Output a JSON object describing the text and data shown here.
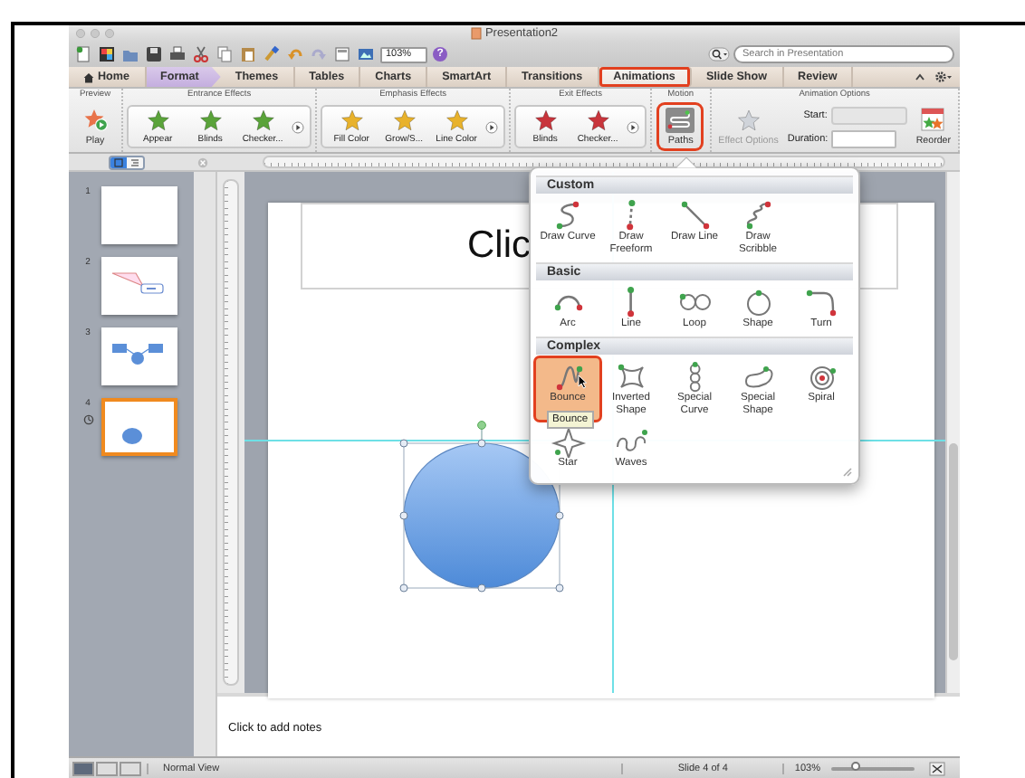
{
  "window": {
    "title": "Presentation2"
  },
  "toolbar": {
    "zoom": "103%",
    "help": "?",
    "search": {
      "placeholder": "Search in Presentation"
    }
  },
  "tabs": [
    {
      "label": "Home",
      "kind": "icon-label",
      "selected": false,
      "contextual": false,
      "highlighted": false
    },
    {
      "label": "Format",
      "kind": "label",
      "selected": false,
      "contextual": true,
      "highlighted": false
    },
    {
      "label": "Themes",
      "kind": "label",
      "selected": false,
      "contextual": false,
      "highlighted": false
    },
    {
      "label": "Tables",
      "kind": "label",
      "selected": false,
      "contextual": false,
      "highlighted": false
    },
    {
      "label": "Charts",
      "kind": "label",
      "selected": false,
      "contextual": false,
      "highlighted": false
    },
    {
      "label": "SmartArt",
      "kind": "label",
      "selected": false,
      "contextual": false,
      "highlighted": false
    },
    {
      "label": "Transitions",
      "kind": "label",
      "selected": false,
      "contextual": false,
      "highlighted": false
    },
    {
      "label": "Animations",
      "kind": "label",
      "selected": true,
      "contextual": false,
      "highlighted": true
    },
    {
      "label": "Slide Show",
      "kind": "label",
      "selected": false,
      "contextual": false,
      "highlighted": false
    },
    {
      "label": "Review",
      "kind": "label",
      "selected": false,
      "contextual": false,
      "highlighted": false
    }
  ],
  "ribbon": [
    {
      "kind": "preview",
      "title": "Preview",
      "button": "Play"
    },
    {
      "kind": "effects",
      "title": "Entrance Effects",
      "color": "#5aa33a",
      "items": [
        "Appear",
        "Blinds",
        "Checker..."
      ]
    },
    {
      "kind": "effects",
      "title": "Emphasis Effects",
      "color": "#e8b22c",
      "items": [
        "Fill Color",
        "Grow/S...",
        "Line Color"
      ]
    },
    {
      "kind": "effects",
      "title": "Exit Effects",
      "color": "#c8353c",
      "items": [
        "Blinds",
        "Checker..."
      ]
    },
    {
      "kind": "motion",
      "title": "Motion",
      "button": "Paths",
      "highlighted": true
    },
    {
      "kind": "options",
      "title": "Animation Options",
      "effect_options": {
        "label": "Effect Options",
        "disabled": true
      },
      "start_label": "Start:",
      "duration_label": "Duration:",
      "reorder": "Reorder"
    }
  ],
  "slides_pane": {
    "view_tabs": [
      {
        "kind": "slides",
        "selected": true
      },
      {
        "kind": "outline",
        "selected": false
      }
    ],
    "slides": [
      {
        "number": "1",
        "kind": "blank",
        "selected": false,
        "animated": false
      },
      {
        "number": "2",
        "kind": "diagram",
        "selected": false,
        "animated": false
      },
      {
        "number": "3",
        "kind": "flow",
        "selected": false,
        "animated": false
      },
      {
        "number": "4",
        "kind": "circle",
        "selected": true,
        "animated": true
      }
    ]
  },
  "slide": {
    "title": "Clic"
  },
  "notes": {
    "placeholder": "Click to add notes"
  },
  "motion_menu": {
    "tooltip": "Bounce",
    "sections": [
      {
        "title": "Custom",
        "items": [
          {
            "label": "Draw Curve",
            "kind": "curve",
            "selected": false,
            "highlighted": false
          },
          {
            "label": "Draw Freeform",
            "kind": "freeform",
            "selected": false,
            "highlighted": false
          },
          {
            "label": "Draw Line",
            "kind": "line",
            "selected": false,
            "highlighted": false
          },
          {
            "label": "Draw Scribble",
            "kind": "scribble",
            "selected": false,
            "highlighted": false
          }
        ]
      },
      {
        "title": "Basic",
        "items": [
          {
            "label": "Arc",
            "kind": "arc",
            "selected": false,
            "highlighted": false
          },
          {
            "label": "Line",
            "kind": "vline",
            "selected": false,
            "highlighted": false
          },
          {
            "label": "Loop",
            "kind": "loop",
            "selected": false,
            "highlighted": false
          },
          {
            "label": "Shape",
            "kind": "circle",
            "selected": false,
            "highlighted": false
          },
          {
            "label": "Turn",
            "kind": "turn",
            "selected": false,
            "highlighted": false
          }
        ]
      },
      {
        "title": "Complex",
        "items": [
          {
            "label": "Bounce",
            "kind": "bounce",
            "selected": true,
            "highlighted": true
          },
          {
            "label": "Inverted Shape",
            "kind": "inverted",
            "selected": false,
            "highlighted": false
          },
          {
            "label": "Special Curve",
            "kind": "special-curve",
            "selected": false,
            "highlighted": false
          },
          {
            "label": "Special Shape",
            "kind": "special-shape",
            "selected": false,
            "highlighted": false
          },
          {
            "label": "Spiral",
            "kind": "spiral",
            "selected": false,
            "highlighted": false
          },
          {
            "label": "Star",
            "kind": "star",
            "selected": false,
            "highlighted": false
          },
          {
            "label": "Waves",
            "kind": "waves",
            "selected": false,
            "highlighted": false
          }
        ]
      }
    ]
  },
  "status_bar": {
    "view": "Normal View",
    "slide": "Slide 4 of 4",
    "zoom": "103%",
    "level": 0.3
  }
}
